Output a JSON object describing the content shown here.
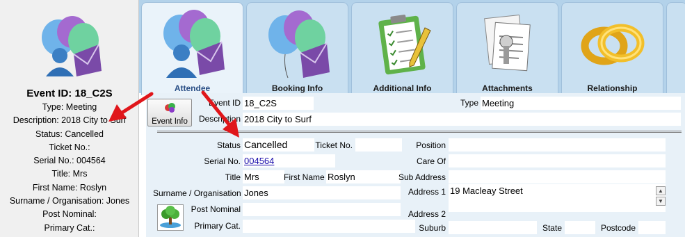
{
  "summary": {
    "title": "Event ID: 18_C2S",
    "lines": [
      "Type: Meeting",
      "Description: 2018 City to Surf",
      "Status: Cancelled",
      "Ticket No.:",
      "Serial No.: 004564",
      "Title: Mrs",
      "First Name: Roslyn",
      "Surname / Organisation: Jones",
      "Post Nominal:",
      "Primary Cat.:"
    ]
  },
  "tabs": [
    {
      "label": "Attendee",
      "icon": "balloons-people-icon",
      "active": true
    },
    {
      "label": "Booking Info",
      "icon": "balloons-icon",
      "active": false
    },
    {
      "label": "Additional Info",
      "icon": "clipboard-checklist-icon",
      "active": false
    },
    {
      "label": "Attachments",
      "icon": "paperclip-documents-icon",
      "active": false
    },
    {
      "label": "Relationship",
      "icon": "rings-icon",
      "active": false
    }
  ],
  "event_button": {
    "label": "Event Info",
    "icon": "balloons-icon"
  },
  "form": {
    "event_id": {
      "label": "Event ID",
      "value": "18_C2S"
    },
    "type": {
      "label": "Type",
      "value": "Meeting"
    },
    "description": {
      "label": "Description",
      "value": "2018 City to Surf"
    },
    "status": {
      "label": "Status",
      "value": "Cancelled"
    },
    "ticket_no": {
      "label": "Ticket No.",
      "value": ""
    },
    "position": {
      "label": "Position",
      "value": ""
    },
    "serial_no": {
      "label": "Serial No.",
      "value": "004564"
    },
    "care_of": {
      "label": "Care Of",
      "value": ""
    },
    "title": {
      "label": "Title",
      "value": "Mrs"
    },
    "first_name": {
      "label": "First Name",
      "value": "Roslyn"
    },
    "sub_address": {
      "label": "Sub Address",
      "value": ""
    },
    "surname": {
      "label": "Surname / Organisation",
      "value": "Jones"
    },
    "address1": {
      "label": "Address 1",
      "value": "19 Macleay Street"
    },
    "post_nominal": {
      "label": "Post Nominal",
      "value": ""
    },
    "address2": {
      "label": "Address 2",
      "value": ""
    },
    "primary_cat": {
      "label": "Primary Cat.",
      "value": ""
    },
    "suburb": {
      "label": "Suburb",
      "value": ""
    },
    "state": {
      "label": "State",
      "value": ""
    },
    "postcode": {
      "label": "Postcode",
      "value": ""
    }
  },
  "colors": {
    "tab_strip": "#b3d2ea",
    "active_tab_label": "#2a4f86",
    "form_background": "#e8f1f8",
    "annotation_arrow": "#e0161b",
    "link": "#1a0dab"
  }
}
